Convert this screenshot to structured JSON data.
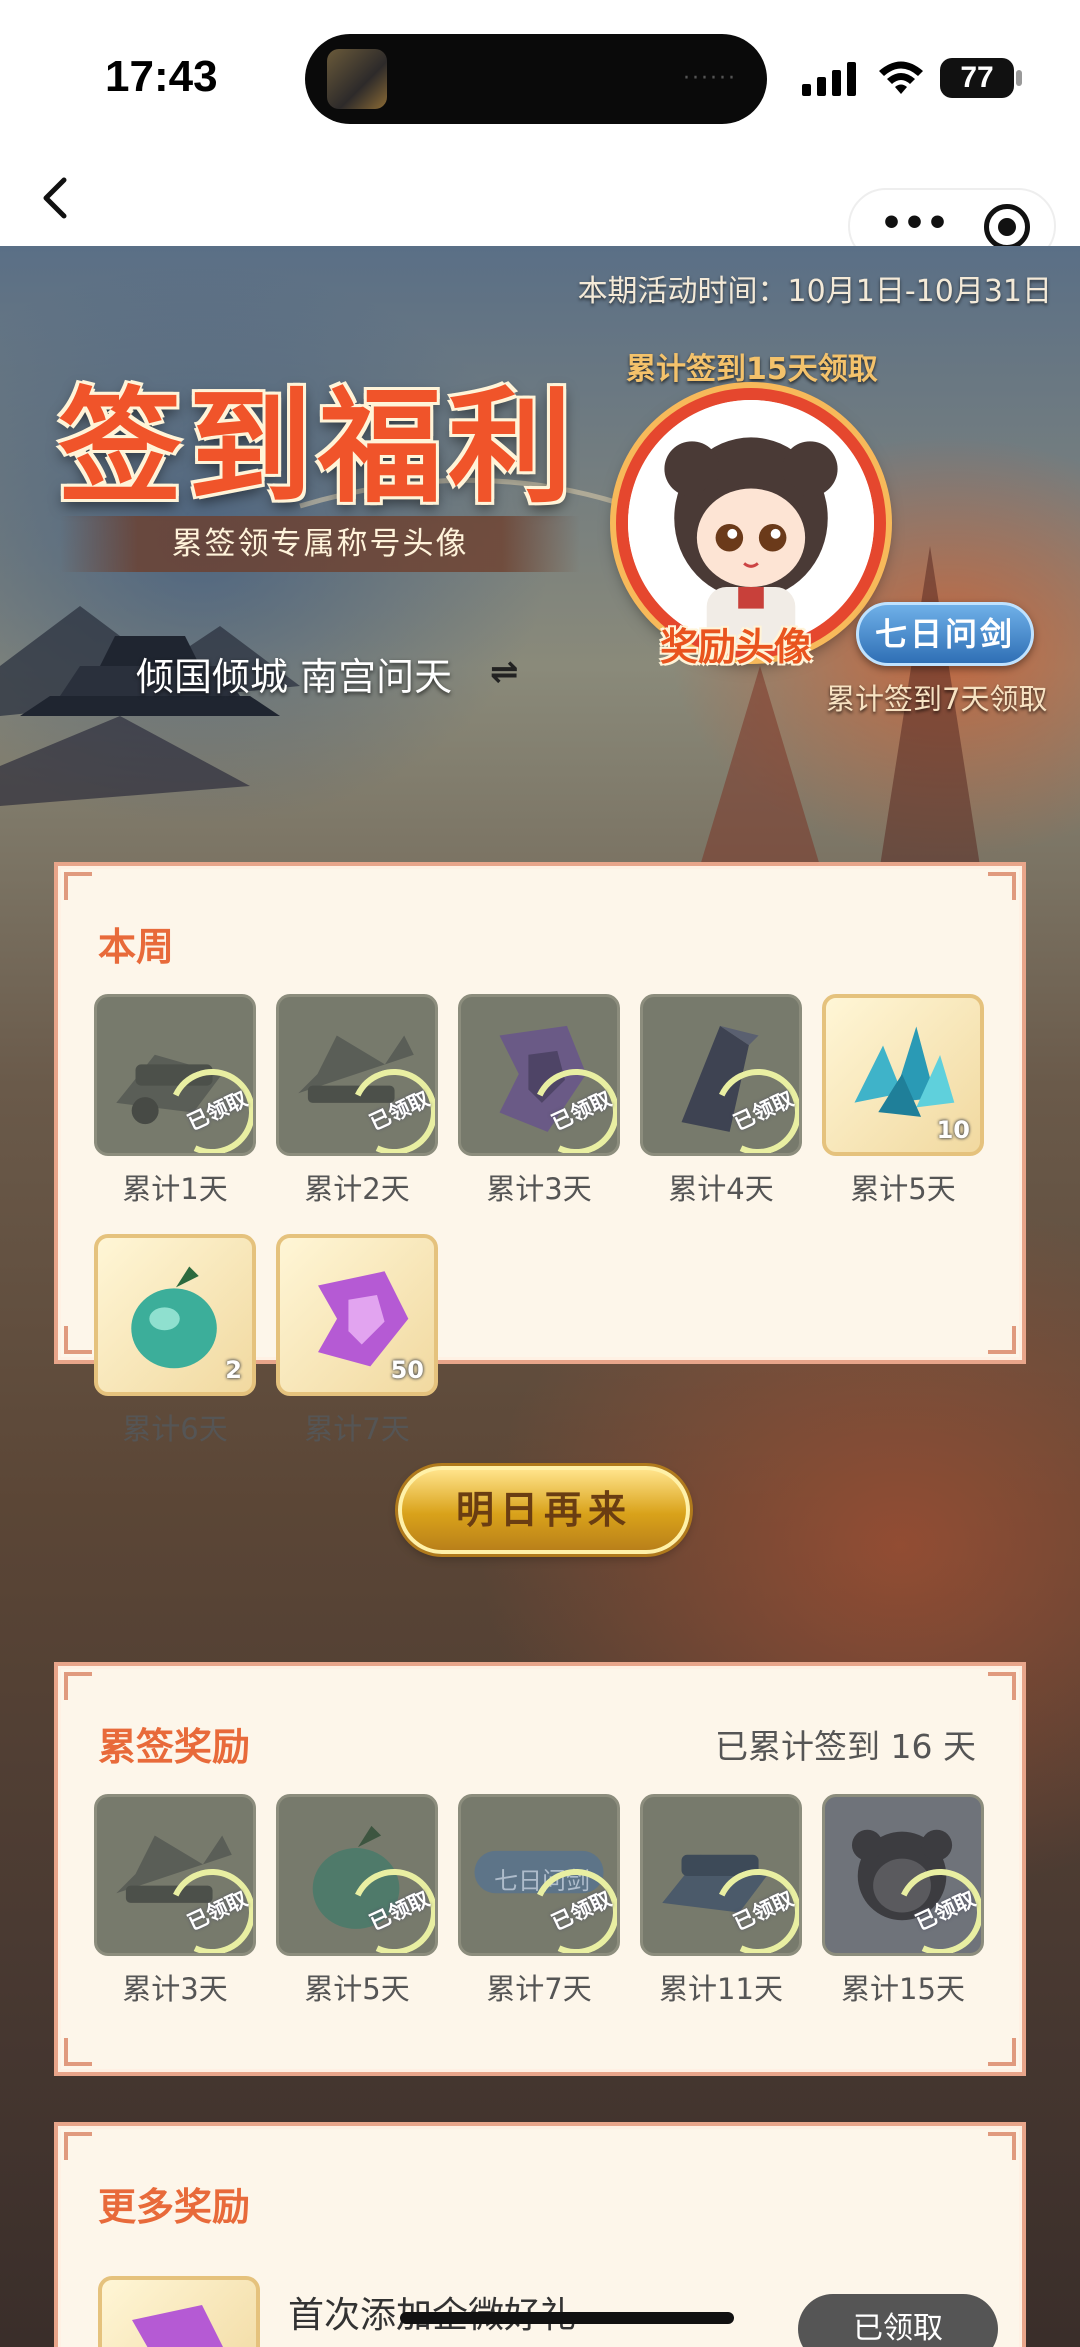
{
  "status_bar": {
    "time": "17:43",
    "battery": "77"
  },
  "activity": {
    "period": "本期活动时间：10月1日-10月31日",
    "title": "签到福利",
    "subtitle": "累签领专属称号头像",
    "name_display": "倾国倾城 南宫问天",
    "avatar_hint": "累计签到15天领取",
    "avatar_label": "奖励头像",
    "badge": "七日问剑",
    "badge_hint": "累计签到7天领取"
  },
  "weekly": {
    "title": "本周",
    "claimed_text": "已领取",
    "items": [
      {
        "label": "累计1天",
        "claimed": true,
        "icon": "cannon-icon"
      },
      {
        "label": "累计2天",
        "claimed": true,
        "icon": "crossbow-icon"
      },
      {
        "label": "累计3天",
        "claimed": true,
        "icon": "purple-fragment-icon"
      },
      {
        "label": "累计4天",
        "claimed": true,
        "icon": "dark-crystal-icon"
      },
      {
        "label": "累计5天",
        "claimed": false,
        "icon": "blue-crystal-icon",
        "qty": "10"
      },
      {
        "label": "累计6天",
        "claimed": false,
        "icon": "green-fruit-icon",
        "qty": "2"
      },
      {
        "label": "累计7天",
        "claimed": false,
        "icon": "purple-fragment-icon",
        "qty": "50"
      }
    ],
    "button": "明日再来"
  },
  "cumulative": {
    "title": "累签奖励",
    "meta": "已累计签到 16 天",
    "claimed_text": "已领取",
    "items": [
      {
        "label": "累计3天",
        "icon": "crossbow-icon"
      },
      {
        "label": "累计5天",
        "icon": "green-fruit-icon"
      },
      {
        "label": "累计7天",
        "icon": "badge-icon",
        "badge_text": "七日问剑"
      },
      {
        "label": "累计11天",
        "icon": "cannon-icon"
      },
      {
        "label": "累计15天",
        "icon": "avatar-icon"
      }
    ]
  },
  "more": {
    "title": "更多奖励",
    "item_title": "首次添加企微好礼",
    "claim_button": "已领取"
  },
  "colors": {
    "accent": "#e86a3a",
    "card_bg": "#fdf6ea",
    "card_border": "#e8a58a",
    "claimed_ring": "#e9efa2"
  }
}
